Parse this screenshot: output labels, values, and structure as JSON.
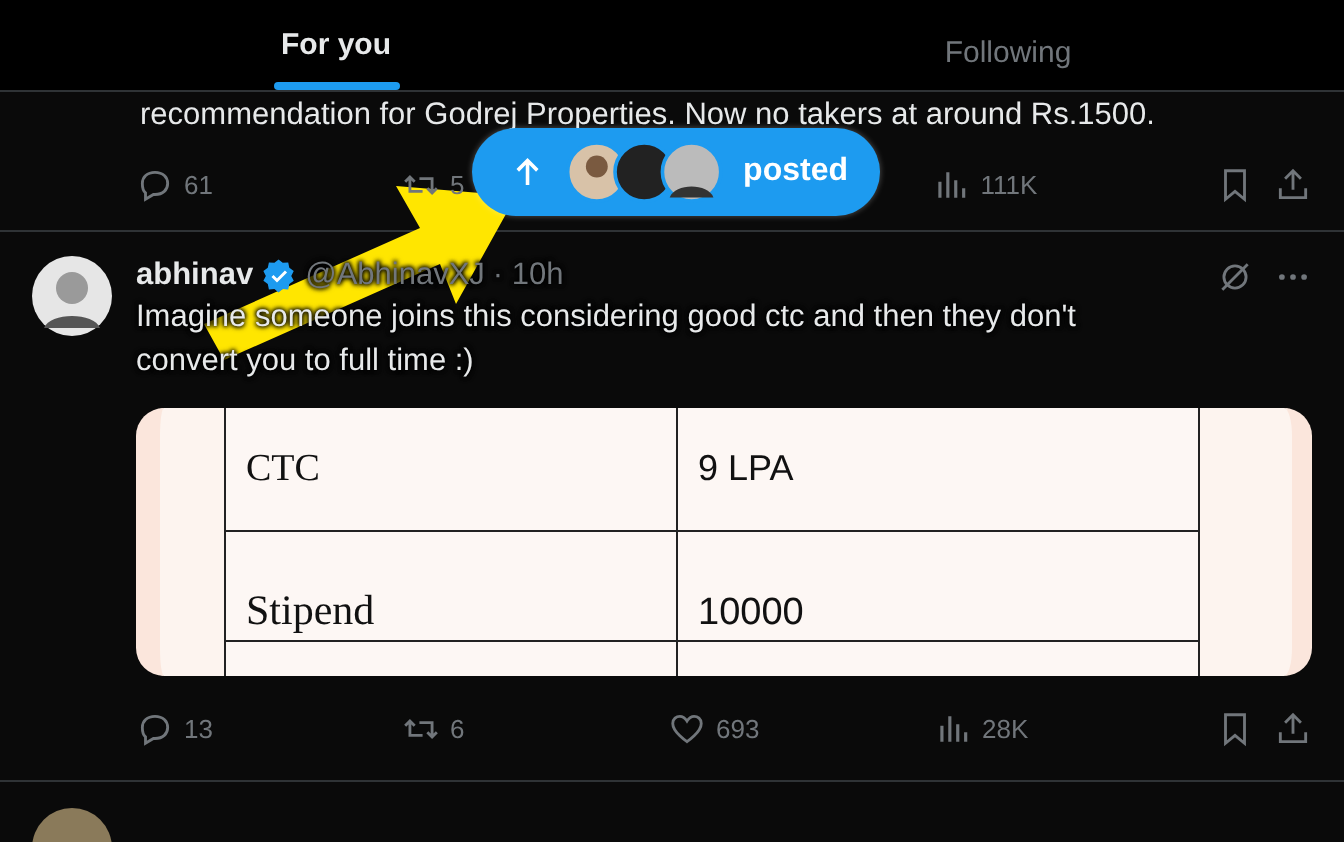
{
  "tabs": [
    {
      "label": "For you",
      "selected": true
    },
    {
      "label": "Following",
      "selected": false
    }
  ],
  "posts": [
    {
      "text": "recommendation for Godrej Properties. Now no takers at around Rs.1500.",
      "actions": {
        "replies": "61",
        "reposts": "5",
        "views": "111K"
      }
    },
    {
      "author": "abhinav",
      "verified": true,
      "handle": "@AbhinavXJ",
      "time": "· 10h",
      "text": "Imagine someone joins this considering good ctc and then they don't convert you to full time :)",
      "table": [
        [
          "CTC",
          "9 LPA"
        ],
        [
          "Stipend",
          "10000"
        ]
      ],
      "actions": {
        "replies": "13",
        "reposts": "6",
        "likes": "693",
        "views": "28K"
      }
    }
  ],
  "new_posts_pill": {
    "label": "posted"
  }
}
